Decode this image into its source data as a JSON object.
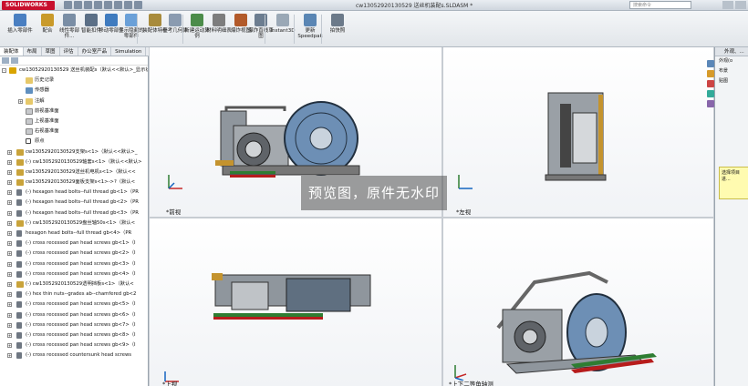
{
  "app": {
    "logo": "SOLIDWORKS",
    "doc_title": "cw13052920130529 送丝机装配s.SLDASM *",
    "search_placeholder": "搜索命令"
  },
  "ribbon": [
    {
      "label": "插入零部件",
      "color": "#4a7fc1"
    },
    {
      "label": "配合",
      "color": "#c99a2a"
    },
    {
      "label": "线性零部件...",
      "color": "#7a8ea5"
    },
    {
      "label": "智能扣件",
      "color": "#5b6f86"
    },
    {
      "label": "移动零部件",
      "color": "#3f7bbf"
    },
    {
      "label": "显示隐藏的零部件",
      "color": "#6aa0d8"
    },
    {
      "label": "装配体特征",
      "color": "#a88b3c"
    },
    {
      "label": "参考几何体",
      "color": "#8a9bb0"
    },
    {
      "label": "新建运动算例",
      "color": "#4c8c4a"
    },
    {
      "label": "材料明细表",
      "color": "#7d7d7d"
    },
    {
      "label": "爆炸视图",
      "color": "#b25a2a"
    },
    {
      "label": "爆炸直线草图",
      "color": "#6c7d90"
    },
    {
      "label": "Instant3D",
      "color": "#9aa8b6"
    },
    {
      "label": "更新Speedpak",
      "color": "#5a86b4"
    },
    {
      "label": "拍快照",
      "color": "#6c7a8a"
    }
  ],
  "tabs": [
    "装配体",
    "布局",
    "草图",
    "评估",
    "办公室产品",
    "Simulation"
  ],
  "tree": {
    "root": "cw13052920130529 送丝机装配s（默认<<默认>_显示状态-1>）",
    "items": [
      {
        "label": "历史记录",
        "icon": "folder",
        "level": 1
      },
      {
        "label": "传感器",
        "icon": "sensor",
        "level": 1
      },
      {
        "label": "注解",
        "icon": "folder",
        "level": 1,
        "exp": true
      },
      {
        "label": "前视基准面",
        "icon": "plane",
        "level": 1
      },
      {
        "label": "上视基准面",
        "icon": "plane",
        "level": 1
      },
      {
        "label": "右视基准面",
        "icon": "plane",
        "level": 1
      },
      {
        "label": "原点",
        "icon": "origin",
        "level": 1
      },
      {
        "label": "cw13052920130529支架s<1>（默认<<默认>_",
        "icon": "part",
        "level": 0,
        "exp": true
      },
      {
        "label": "(-) cw13052920130529轴套s<1>（默认<<默认>",
        "icon": "part",
        "level": 0,
        "exp": true
      },
      {
        "label": "cw13052920130529送丝机电机s<1>（默认<<",
        "icon": "part",
        "level": 0,
        "exp": true
      },
      {
        "label": "cw13052920130529面板支架s<1>->?（默认<",
        "icon": "part",
        "level": 0,
        "exp": true
      },
      {
        "label": "(-) hexagon head bolts--full thread gb<1>（PR",
        "icon": "bolt",
        "level": 0,
        "exp": true
      },
      {
        "label": "(-) hexagon head bolts--full thread gb<2>（PR",
        "icon": "bolt",
        "level": 0,
        "exp": true
      },
      {
        "label": "(-) hexagon head bolts--full thread gb<3>（PR",
        "icon": "bolt",
        "level": 0,
        "exp": true
      },
      {
        "label": "(-) cw13052920130529盘丝轴50s<1>（默认<",
        "icon": "part",
        "level": 0,
        "exp": true
      },
      {
        "label": "hexagon head bolts--full thread gb<4>（PR",
        "icon": "bolt",
        "level": 0,
        "exp": true
      },
      {
        "label": "(-) cross recessed pan head screws gb<1>（I",
        "icon": "bolt",
        "level": 0,
        "exp": true
      },
      {
        "label": "(-) cross recessed pan head screws gb<2>（I",
        "icon": "bolt",
        "level": 0,
        "exp": true
      },
      {
        "label": "(-) cross recessed pan head screws gb<3>（I",
        "icon": "bolt",
        "level": 0,
        "exp": true
      },
      {
        "label": "(-) cross recessed pan head screws gb<4>（I",
        "icon": "bolt",
        "level": 0,
        "exp": true
      },
      {
        "label": "(-) cw13052920130529透明挡板s<1>（默认<",
        "icon": "part",
        "level": 0,
        "exp": true
      },
      {
        "label": "(-) hex thin nuts--grades ab--chamfered gb<2",
        "icon": "bolt",
        "level": 0,
        "exp": true
      },
      {
        "label": "(-) cross recessed pan head screws gb<5>（I",
        "icon": "bolt",
        "level": 0,
        "exp": true
      },
      {
        "label": "(-) cross recessed pan head screws gb<6>（I",
        "icon": "bolt",
        "level": 0,
        "exp": true
      },
      {
        "label": "(-) cross recessed pan head screws gb<7>（I",
        "icon": "bolt",
        "level": 0,
        "exp": true
      },
      {
        "label": "(-) cross recessed pan head screws gb<8>（I",
        "icon": "bolt",
        "level": 0,
        "exp": true
      },
      {
        "label": "(-) cross recessed pan head screws gb<9>（I",
        "icon": "bolt",
        "level": 0,
        "exp": true
      },
      {
        "label": "(-) cross recessed countersunk head screws",
        "icon": "bolt",
        "level": 0,
        "exp": true
      }
    ]
  },
  "viewports": {
    "front": "*前视",
    "left": "*左视",
    "top": "*上视",
    "iso": "*上下二等角轴测"
  },
  "watermark": "预览图，原件无水印",
  "task_pane": {
    "title": "外观、...",
    "items": [
      "外观(o",
      "布景",
      "贴图"
    ],
    "tip": "选择项目进..."
  }
}
